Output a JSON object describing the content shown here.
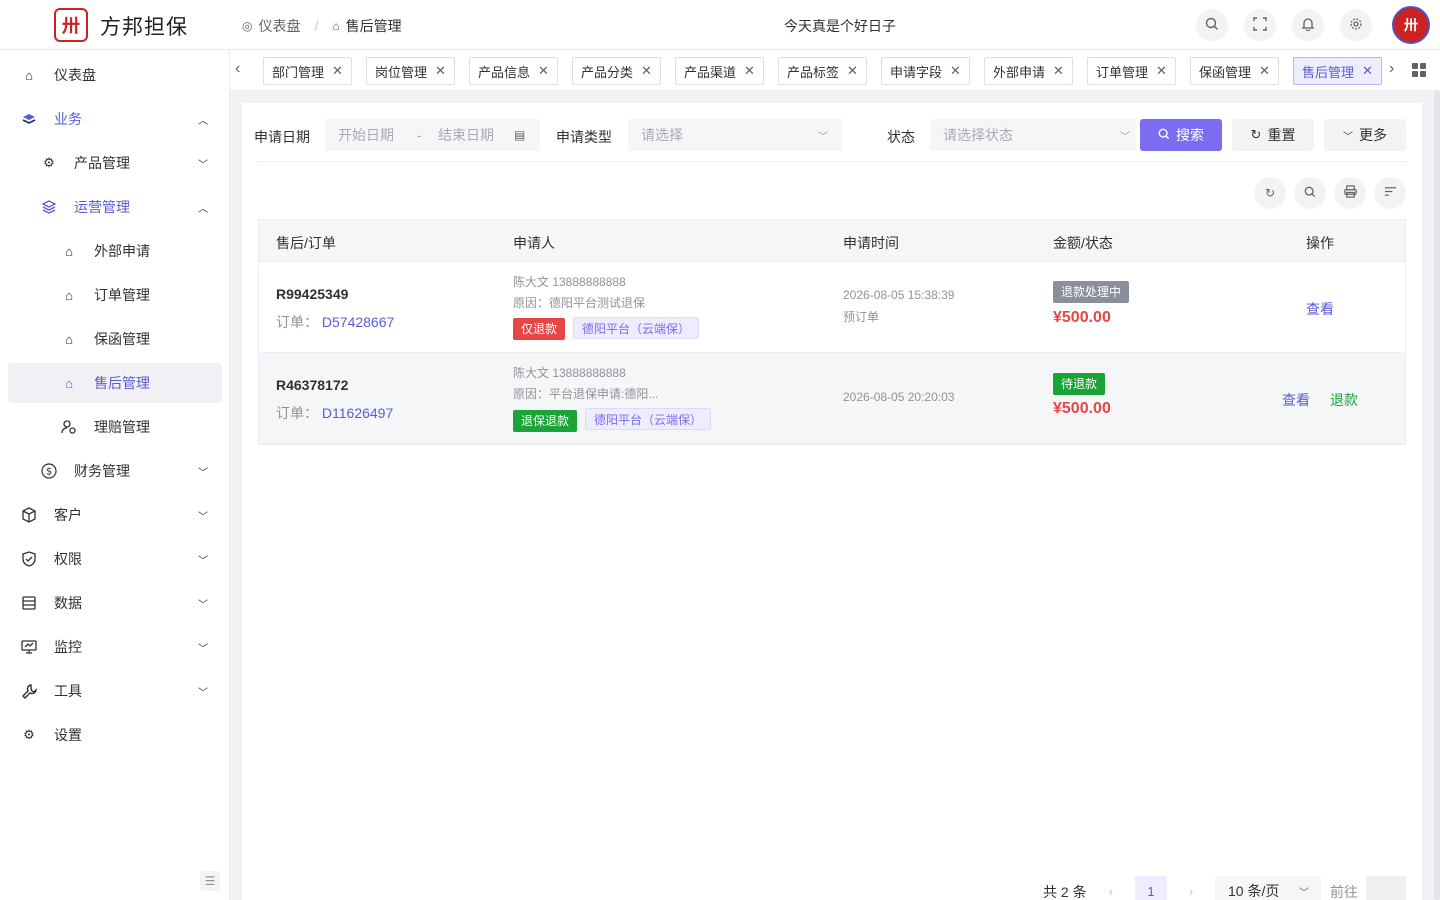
{
  "header": {
    "brand": "方邦担保",
    "logo_glyph": "卅",
    "breadcrumb": [
      "仪表盘",
      "售后管理"
    ],
    "breadcrumb_sep": "/",
    "motto": "今天真是个好日子"
  },
  "sidebar": {
    "dashboard": "仪表盘",
    "business": "业务",
    "product_mgmt": "产品管理",
    "ops_mgmt": "运营管理",
    "external_apply": "外部申请",
    "order_mgmt": "订单管理",
    "guarantee_mgmt": "保函管理",
    "aftersale_mgmt": "售后管理",
    "claim_mgmt": "理赔管理",
    "finance_mgmt": "财务管理",
    "customer": "客户",
    "permission": "权限",
    "data": "数据",
    "monitor": "监控",
    "tools": "工具",
    "settings": "设置"
  },
  "tabs": [
    "部门管理",
    "岗位管理",
    "产品信息",
    "产品分类",
    "产品渠道",
    "产品标签",
    "申请字段",
    "外部申请",
    "订单管理",
    "保函管理",
    "售后管理"
  ],
  "filters": {
    "date_label": "申请日期",
    "start_placeholder": "开始日期",
    "range_sep": "-",
    "end_placeholder": "结束日期",
    "type_label": "申请类型",
    "type_placeholder": "请选择",
    "status_label": "状态",
    "status_placeholder": "请选择状态",
    "search": "搜索",
    "reset": "重置",
    "more": "更多"
  },
  "table": {
    "headers": [
      "售后/订单",
      "申请人",
      "申请时间",
      "金额/状态",
      "操作"
    ],
    "order_prefix": "订单：",
    "rows": [
      {
        "aftersale_no": "R99425349",
        "order_no": "D57428667",
        "applicant": "陈大文 13888888888",
        "reason": "原因：德阳平台测试退保",
        "type_tag": "仅退款",
        "channel_tag": "德阳平台（云端保）",
        "time": "2026-08-05 15:38:39",
        "sub_time": "预订单",
        "status": "退款处理中",
        "amount": "¥500.00",
        "actions": [
          "查看"
        ]
      },
      {
        "aftersale_no": "R46378172",
        "order_no": "D11626497",
        "applicant": "陈大文 13888888888",
        "reason": "原因：平台退保申请:德阳...",
        "type_tag": "退保退款",
        "channel_tag": "德阳平台（云端保）",
        "time": "2026-08-05 20:20:03",
        "sub_time": "",
        "status": "待退款",
        "amount": "¥500.00",
        "actions": [
          "查看",
          "退款"
        ]
      }
    ]
  },
  "pagination": {
    "total": "共 2 条",
    "current": "1",
    "page_size": "10 条/页",
    "goto": "前往"
  },
  "colors": {
    "primary": "#7b6cf0",
    "danger": "#e84545",
    "success": "#1aa336"
  }
}
